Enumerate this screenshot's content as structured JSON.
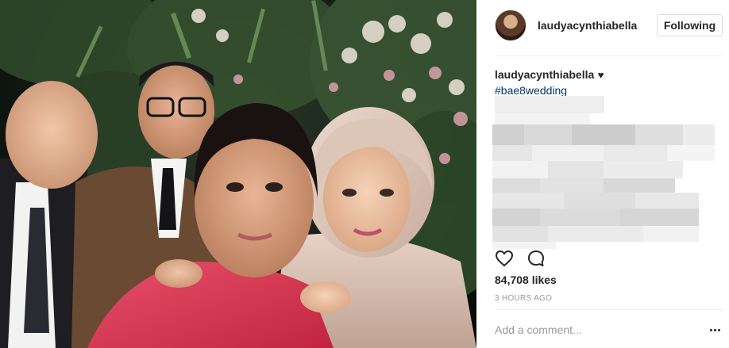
{
  "post": {
    "username": "laudyacynthiabella",
    "follow_label": "Following",
    "caption_username": "laudyacynthiabella",
    "caption_heart": "♥",
    "hashtag": "#bae8wedding",
    "likes": "84,708 likes",
    "time_ago": "3 HOURS AGO",
    "comment_placeholder": "Add a comment...",
    "icons": {
      "like": "heart-icon",
      "comment": "comment-icon",
      "more": "more-options-icon"
    }
  },
  "colors": {
    "link": "#003569",
    "muted": "#999999",
    "border": "#dbdbdb",
    "text": "#262626"
  }
}
